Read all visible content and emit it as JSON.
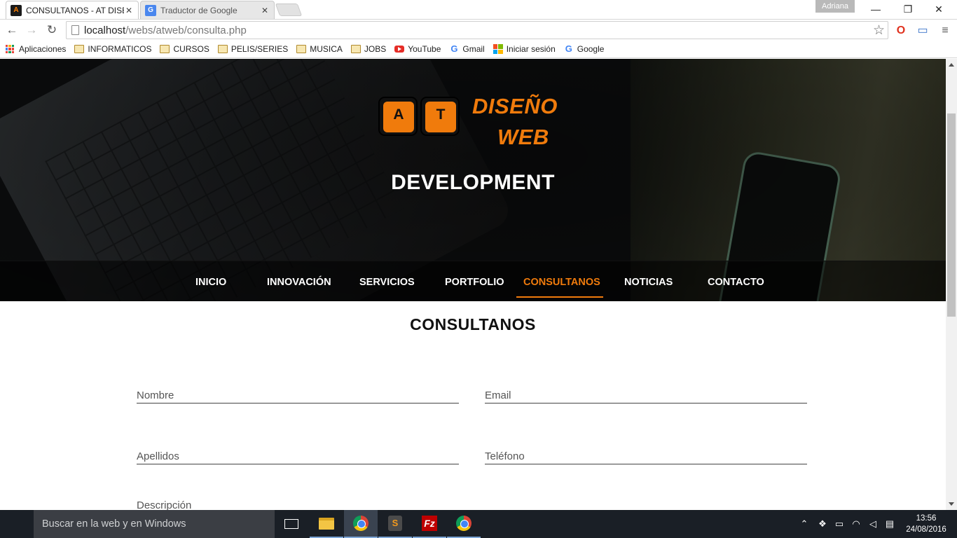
{
  "browser": {
    "tabs": [
      {
        "title": "CONSULTANOS - AT DISEÑO",
        "active": true,
        "icon": "at-logo-icon"
      },
      {
        "title": "Traductor de Google",
        "active": false,
        "icon": "google-translate-icon"
      }
    ],
    "user_name": "Adriana",
    "url_host": "localhost",
    "url_path": "/webs/atweb/consulta.php",
    "bookmarks": [
      {
        "label": "Aplicaciones",
        "icon": "apps-icon"
      },
      {
        "label": "INFORMATICOS",
        "icon": "folder-icon"
      },
      {
        "label": "CURSOS",
        "icon": "folder-icon"
      },
      {
        "label": "PELIS/SERIES",
        "icon": "folder-icon"
      },
      {
        "label": "MUSICA",
        "icon": "folder-icon"
      },
      {
        "label": "JOBS",
        "icon": "folder-icon"
      },
      {
        "label": "YouTube",
        "icon": "youtube-icon"
      },
      {
        "label": "Gmail",
        "icon": "google-icon"
      },
      {
        "label": "Iniciar sesión",
        "icon": "microsoft-icon"
      },
      {
        "label": "Google",
        "icon": "google-icon"
      }
    ]
  },
  "site": {
    "logo_keys": [
      "A",
      "T"
    ],
    "logo_word_1": "DISEÑO",
    "logo_word_2": "WEB",
    "hero_title": "DEVELOPMENT",
    "nav": [
      {
        "label": "INICIO",
        "active": false
      },
      {
        "label": "INNOVACIÓN",
        "active": false
      },
      {
        "label": "SERVICIOS",
        "active": false
      },
      {
        "label": "PORTFOLIO",
        "active": false
      },
      {
        "label": "CONSULTANOS",
        "active": true
      },
      {
        "label": "NOTICIAS",
        "active": false
      },
      {
        "label": "CONTACTO",
        "active": false
      }
    ],
    "section_title": "CONSULTANOS",
    "form": {
      "nombre": "Nombre",
      "email": "Email",
      "apellidos": "Apellidos",
      "telefono": "Teléfono",
      "descripcion": "Descripción"
    }
  },
  "colors": {
    "accent": "#f07b0c",
    "hero_bg": "#0b0c0d",
    "taskbar": "#1a1f26"
  },
  "taskbar": {
    "search_placeholder": "Buscar en la web y en Windows",
    "time": "13:56",
    "date": "24/08/2016"
  }
}
